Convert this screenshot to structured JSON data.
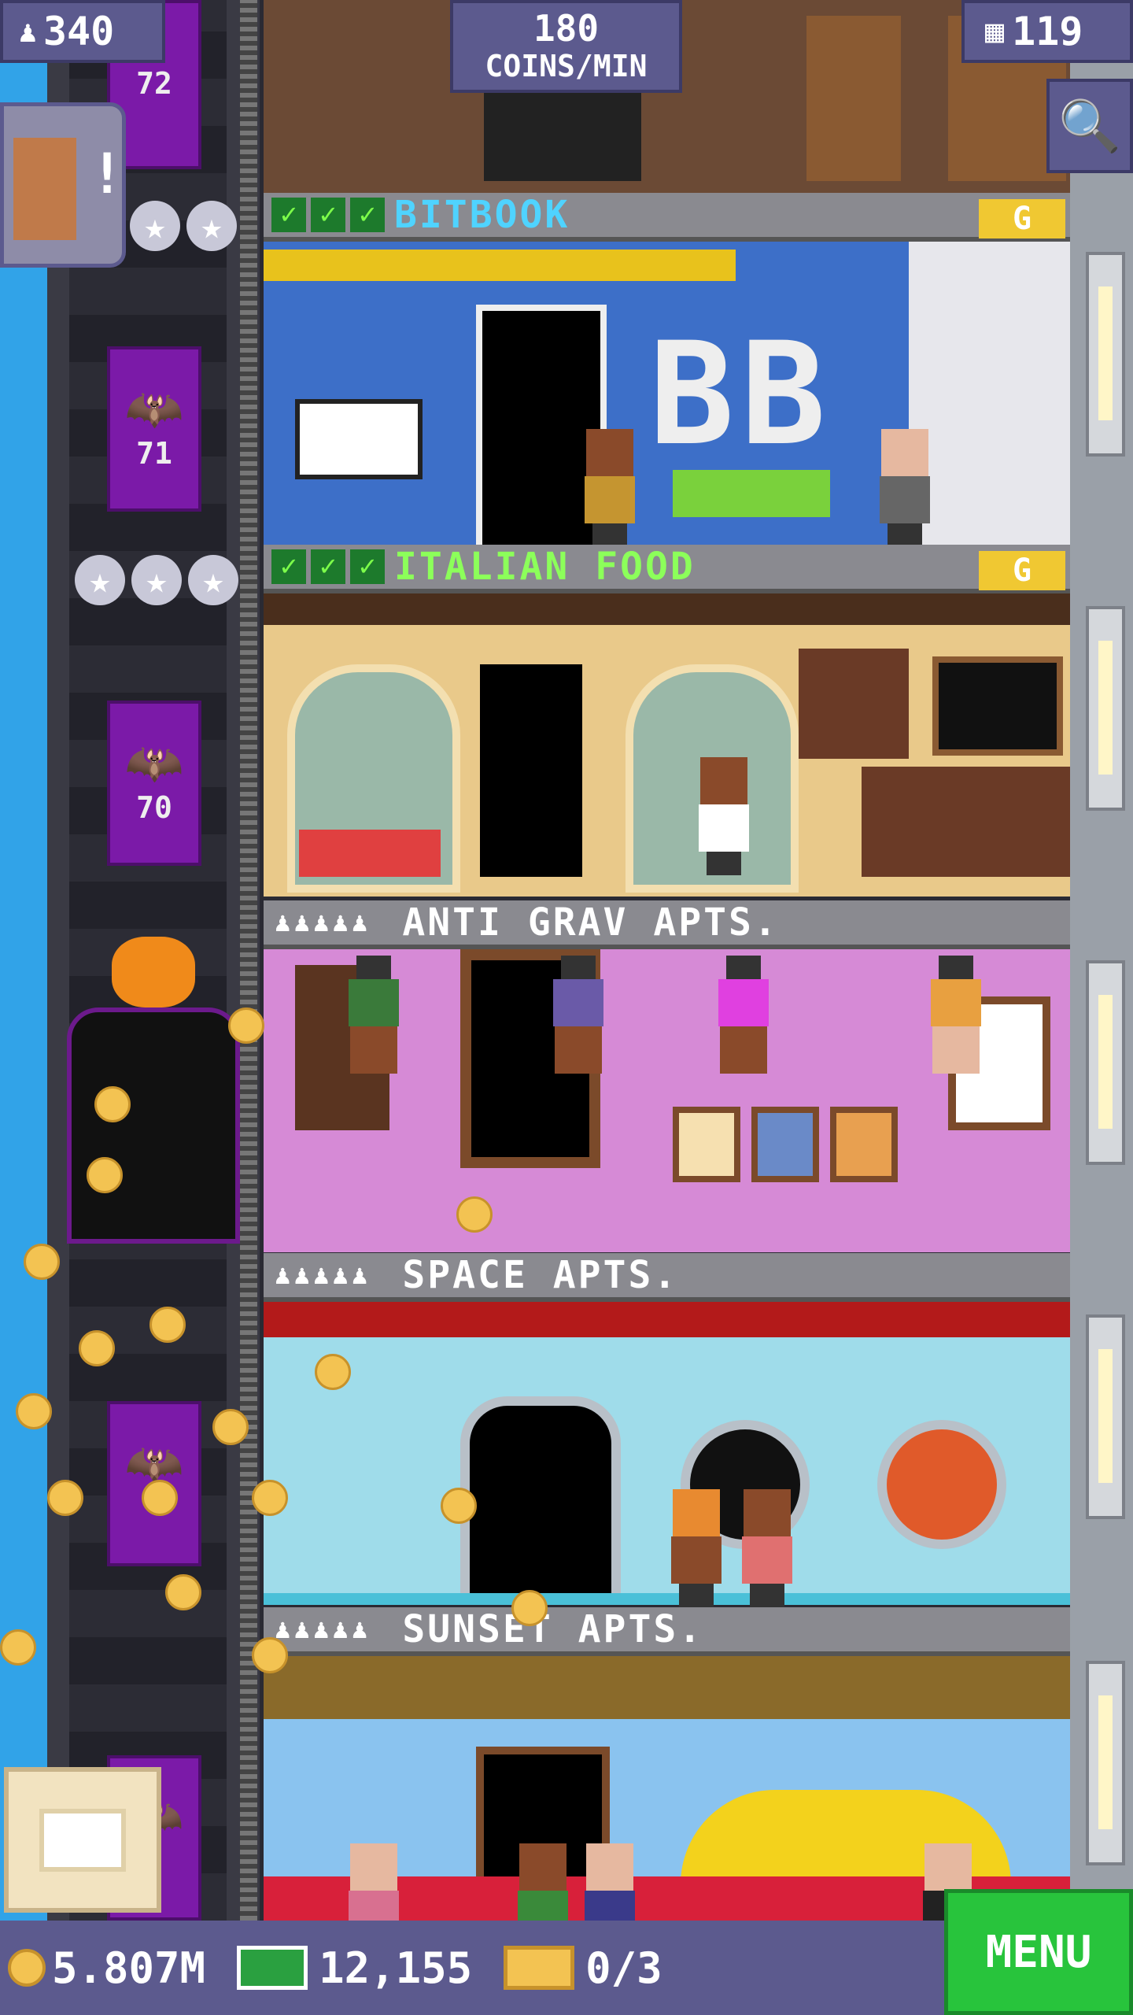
{
  "hud": {
    "population": "340",
    "coins_per_min_value": "180",
    "coins_per_min_unit": "COINS/MIN",
    "floors": "119"
  },
  "elevator_floor_numbers": [
    "72",
    "71",
    "70"
  ],
  "floors": [
    {
      "title": "BITBOOK",
      "checks": 3,
      "badge": "G",
      "title_color": "#4fd3ff",
      "room_color": "#3d6fc8",
      "room_sign": "BB"
    },
    {
      "title": "ITALIAN FOOD",
      "checks": 3,
      "badge": "G",
      "title_color": "#8cff5a",
      "room_color": "#e9c98a"
    },
    {
      "title": "ANTI GRAV APTS.",
      "person_icons": "♟♟♟♟♟",
      "room_color": "#d68ad6"
    },
    {
      "title": "SPACE APTS.",
      "person_icons": "♟♟♟♟♟",
      "room_color": "#9fdcea"
    },
    {
      "title": "SUNSET APTS.",
      "person_icons": "♟♟♟♟♟",
      "room_color": "#8ac3ef"
    }
  ],
  "bottom": {
    "coins": "5.807M",
    "bux": "12,155",
    "golden_tickets": "0/3",
    "menu_label": "MENU"
  },
  "alert_badge": "!",
  "colors": {
    "hud_bg": "#5c5a8e",
    "menu_green": "#28c43c",
    "coin_gold": "#f3c352"
  }
}
